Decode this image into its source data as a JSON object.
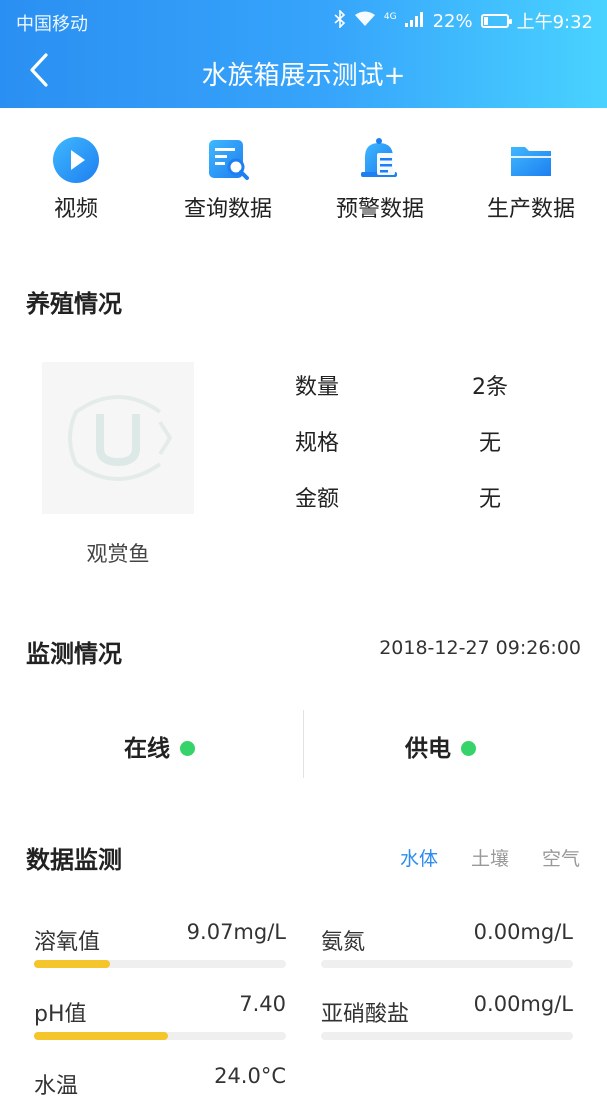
{
  "status_bar": {
    "carrier": "中国移动",
    "network": "4G",
    "battery_percent": "22%",
    "battery_level": 0.22,
    "time": "上午9:32"
  },
  "nav": {
    "title": "水族箱展示测试+"
  },
  "actions": [
    {
      "label": "视频",
      "icon": "play-icon"
    },
    {
      "label": "查询数据",
      "icon": "search-document-icon"
    },
    {
      "label": "预警数据",
      "icon": "alarm-bell-icon"
    },
    {
      "label": "生产数据",
      "icon": "folder-icon"
    }
  ],
  "breeding": {
    "title": "养殖情况",
    "fish_name": "观赏鱼",
    "rows": [
      {
        "label": "数量",
        "value": "2条"
      },
      {
        "label": "规格",
        "value": "无"
      },
      {
        "label": "金额",
        "value": "无"
      }
    ]
  },
  "monitoring": {
    "title": "监测情况",
    "timestamp": "2018-12-27 09:26:00",
    "online_label": "在线",
    "power_label": "供电",
    "status_color": "#35d36a"
  },
  "data_monitoring": {
    "title": "数据监测",
    "tabs": [
      "水体",
      "土壤",
      "空气"
    ],
    "active_tab": "水体",
    "metrics": [
      {
        "label": "溶氧值",
        "value": "9.07mg/L",
        "level": 0.3
      },
      {
        "label": "氨氮",
        "value": "0.00mg/L",
        "level": 0
      },
      {
        "label": "pH值",
        "value": "7.40",
        "level": 0.53
      },
      {
        "label": "亚硝酸盐",
        "value": "0.00mg/L",
        "level": 0
      },
      {
        "label": "水温",
        "value": "24.0°C",
        "level": 0
      }
    ]
  },
  "colors": {
    "header_start": "#2a8ff2",
    "header_end": "#49d2ff",
    "accent": "#2d8cf0",
    "bar_fill": "#f5c52c"
  }
}
